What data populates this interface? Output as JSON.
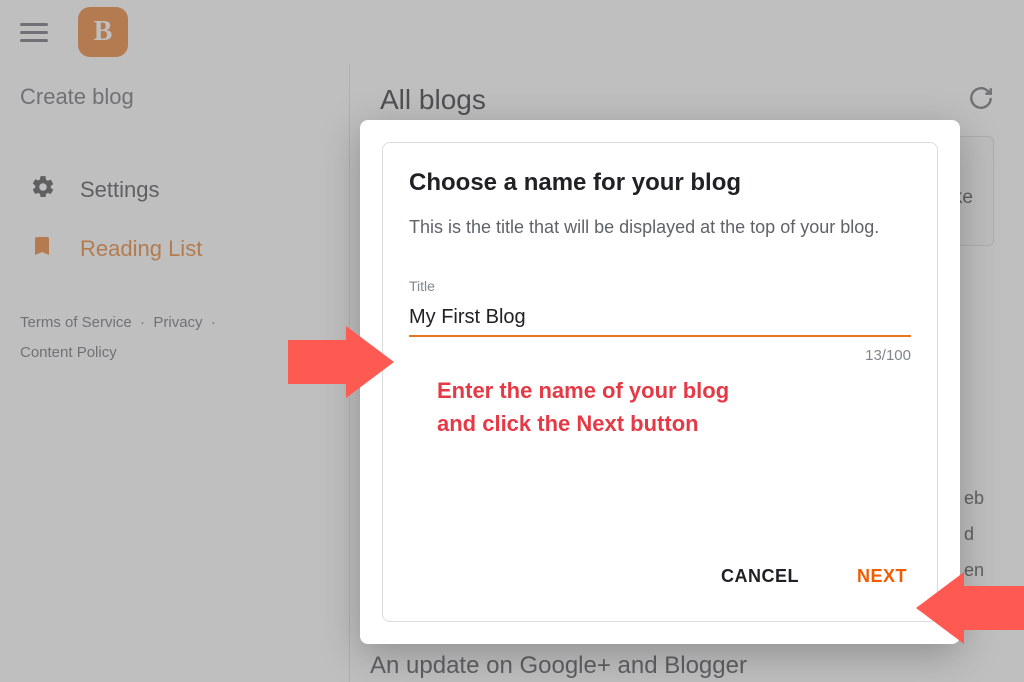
{
  "sidebar": {
    "create_blog": "Create blog",
    "items": [
      {
        "label": "Settings"
      },
      {
        "label": "Reading List"
      }
    ],
    "footer": {
      "line1_a": "Terms of Service",
      "line1_b": "Privacy",
      "line2": "Content Policy"
    }
  },
  "main": {
    "heading": "All blogs",
    "card_hint_partial": "ike",
    "bg_partial_lines": {
      "a": "eb",
      "b": "d",
      "c": "en"
    },
    "bg_headline_partial": "An update on Google+ and Blogger"
  },
  "modal": {
    "title": "Choose a name for your blog",
    "subtitle": "This is the title that will be displayed at the top of your blog.",
    "input_label": "Title",
    "input_value": "My First Blog",
    "char_count": "13/100",
    "annotation": "Enter the name of your blog\nand click the Next button",
    "cancel": "CANCEL",
    "next": "NEXT"
  }
}
